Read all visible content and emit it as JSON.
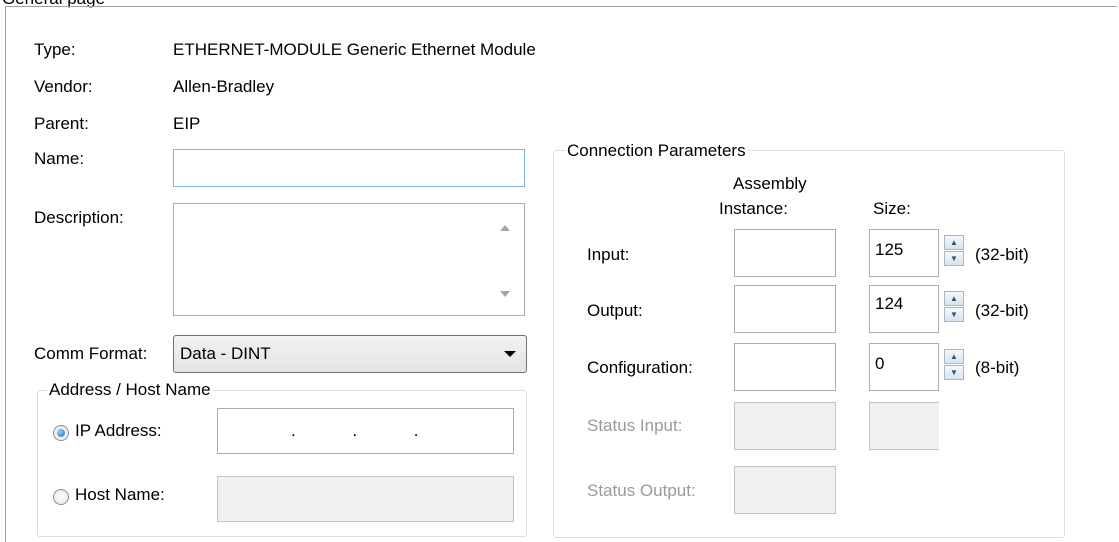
{
  "header_cropped_text": "General  page",
  "module": {
    "type_label": "Type:",
    "type_value": "ETHERNET-MODULE Generic Ethernet Module",
    "vendor_label": "Vendor:",
    "vendor_value": "Allen-Bradley",
    "parent_label": "Parent:",
    "parent_value": "EIP",
    "name_label": "Name:",
    "name_value": "",
    "description_label": "Description:",
    "description_value": "",
    "comm_format_label": "Comm Format:",
    "comm_format_value": "Data - DINT"
  },
  "address": {
    "group_label": "Address / Host Name",
    "ip_label": "IP Address:",
    "ip_dots": ".            .            .",
    "ip_selected": true,
    "host_label": "Host Name:",
    "host_value": ""
  },
  "connection": {
    "group_label": "Connection Parameters",
    "col_assembly_line1": "Assembly",
    "col_assembly_line2": "Instance:",
    "col_size": "Size:",
    "rows": [
      {
        "label": "Input:",
        "instance": "",
        "size": "125",
        "unit": "(32-bit)",
        "enabled": true
      },
      {
        "label": "Output:",
        "instance": "",
        "size": "124",
        "unit": "(32-bit)",
        "enabled": true
      },
      {
        "label": "Configuration:",
        "instance": "",
        "size": "0",
        "unit": "(8-bit)",
        "enabled": true
      },
      {
        "label": "Status Input:",
        "instance": "",
        "size": "",
        "enabled": false
      },
      {
        "label": "Status Output:",
        "instance": "",
        "enabled": false
      }
    ]
  }
}
